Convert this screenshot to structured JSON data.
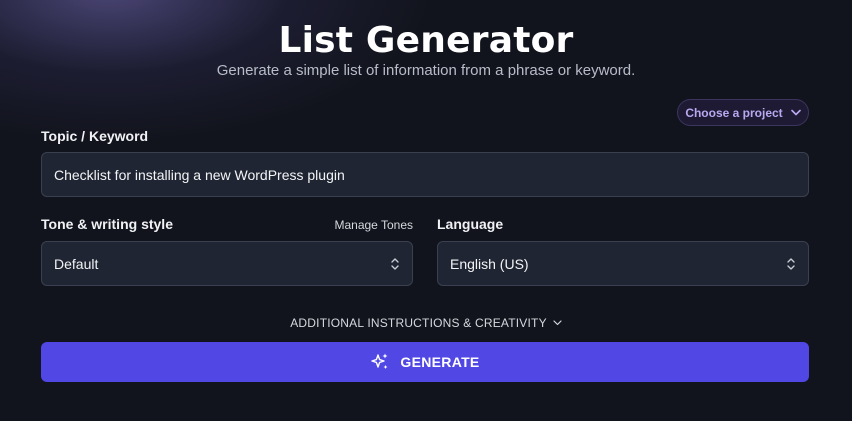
{
  "header": {
    "title": "List Generator",
    "subtitle": "Generate a simple list of information from a phrase or keyword."
  },
  "project": {
    "label": "Choose a project",
    "icon": "chevron-down-icon"
  },
  "topic": {
    "label": "Topic / Keyword",
    "value": "Checklist for installing a new WordPress plugin"
  },
  "tone": {
    "label": "Tone & writing style",
    "manage_label": "Manage Tones",
    "value": "Default",
    "icon": "chevron-updown-icon"
  },
  "language": {
    "label": "Language",
    "value": "English (US)",
    "icon": "chevron-updown-icon"
  },
  "additional": {
    "label": "ADDITIONAL INSTRUCTIONS & CREATIVITY",
    "icon": "chevron-down-icon"
  },
  "generate": {
    "label": "GENERATE",
    "icon": "sparkles-icon"
  },
  "colors": {
    "background": "#12141d",
    "field": "#1f2532",
    "accent": "#5147e5",
    "project_text": "#b9a8f0"
  }
}
